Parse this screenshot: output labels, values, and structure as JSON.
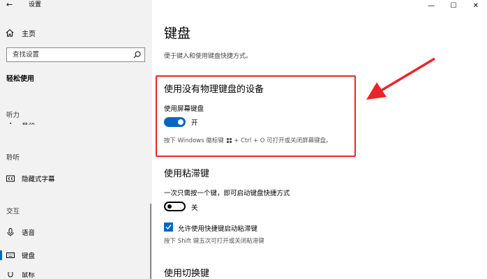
{
  "window": {
    "app_title": "设置",
    "minimize": "—",
    "maximize": "☐",
    "close": "✕"
  },
  "sidebar": {
    "home_label": "主页",
    "search_placeholder": "查找设置",
    "section_title": "轻松使用",
    "groups": [
      {
        "label": "听力"
      },
      {
        "label": "聆听"
      },
      {
        "label": "交互"
      }
    ],
    "items": [
      {
        "label": "音频",
        "group": "听力"
      },
      {
        "label": "隐藏式字幕",
        "group": "聆听"
      },
      {
        "label": "语音",
        "group": "交互"
      },
      {
        "label": "键盘",
        "group": "交互",
        "selected": true
      },
      {
        "label": "鼠标",
        "group": "交互"
      }
    ]
  },
  "main": {
    "page_title": "键盘",
    "page_desc": "便于键入和使用键盘快捷方式。",
    "osk": {
      "heading": "使用没有物理键盘的设备",
      "setting_label": "使用屏幕键盘",
      "toggle_state": "开",
      "toggle_on": true,
      "hint_pre": "按下 Windows 徽标键",
      "hint_post": "+ Ctrl + O 可打开或关闭屏幕键盘。"
    },
    "sticky": {
      "heading": "使用粘滞键",
      "setting_label": "一次只需按一个键，即可启动键盘快捷方式",
      "toggle_state": "关",
      "toggle_on": false,
      "checkbox_label": "允许使用快捷键启动粘滞键",
      "checkbox_checked": true,
      "hint": "按下 Shift 键五次可打开或关闭粘滞键"
    },
    "toggle_keys": {
      "heading": "使用切换键"
    }
  },
  "colors": {
    "accent": "#0067c0",
    "highlight": "#e8262a",
    "sidebar_bg": "#f2f2f2"
  }
}
